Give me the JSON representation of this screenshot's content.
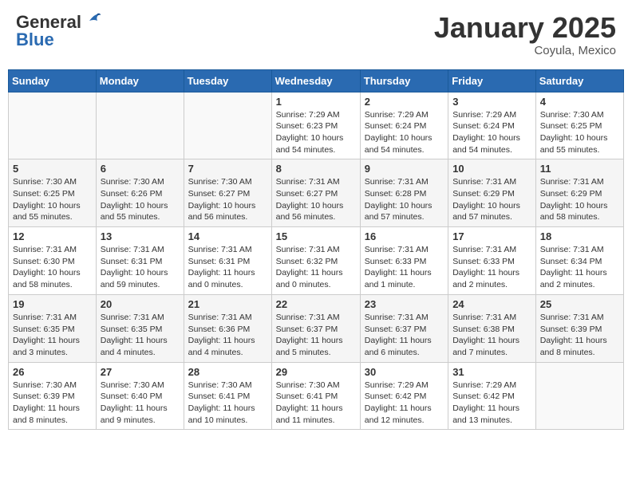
{
  "logo": {
    "line1": "General",
    "line2": "Blue"
  },
  "title": "January 2025",
  "subtitle": "Coyula, Mexico",
  "days_of_week": [
    "Sunday",
    "Monday",
    "Tuesday",
    "Wednesday",
    "Thursday",
    "Friday",
    "Saturday"
  ],
  "weeks": [
    [
      {
        "day": "",
        "info": ""
      },
      {
        "day": "",
        "info": ""
      },
      {
        "day": "",
        "info": ""
      },
      {
        "day": "1",
        "info": "Sunrise: 7:29 AM\nSunset: 6:23 PM\nDaylight: 10 hours\nand 54 minutes."
      },
      {
        "day": "2",
        "info": "Sunrise: 7:29 AM\nSunset: 6:24 PM\nDaylight: 10 hours\nand 54 minutes."
      },
      {
        "day": "3",
        "info": "Sunrise: 7:29 AM\nSunset: 6:24 PM\nDaylight: 10 hours\nand 54 minutes."
      },
      {
        "day": "4",
        "info": "Sunrise: 7:30 AM\nSunset: 6:25 PM\nDaylight: 10 hours\nand 55 minutes."
      }
    ],
    [
      {
        "day": "5",
        "info": "Sunrise: 7:30 AM\nSunset: 6:25 PM\nDaylight: 10 hours\nand 55 minutes."
      },
      {
        "day": "6",
        "info": "Sunrise: 7:30 AM\nSunset: 6:26 PM\nDaylight: 10 hours\nand 55 minutes."
      },
      {
        "day": "7",
        "info": "Sunrise: 7:30 AM\nSunset: 6:27 PM\nDaylight: 10 hours\nand 56 minutes."
      },
      {
        "day": "8",
        "info": "Sunrise: 7:31 AM\nSunset: 6:27 PM\nDaylight: 10 hours\nand 56 minutes."
      },
      {
        "day": "9",
        "info": "Sunrise: 7:31 AM\nSunset: 6:28 PM\nDaylight: 10 hours\nand 57 minutes."
      },
      {
        "day": "10",
        "info": "Sunrise: 7:31 AM\nSunset: 6:29 PM\nDaylight: 10 hours\nand 57 minutes."
      },
      {
        "day": "11",
        "info": "Sunrise: 7:31 AM\nSunset: 6:29 PM\nDaylight: 10 hours\nand 58 minutes."
      }
    ],
    [
      {
        "day": "12",
        "info": "Sunrise: 7:31 AM\nSunset: 6:30 PM\nDaylight: 10 hours\nand 58 minutes."
      },
      {
        "day": "13",
        "info": "Sunrise: 7:31 AM\nSunset: 6:31 PM\nDaylight: 10 hours\nand 59 minutes."
      },
      {
        "day": "14",
        "info": "Sunrise: 7:31 AM\nSunset: 6:31 PM\nDaylight: 11 hours\nand 0 minutes."
      },
      {
        "day": "15",
        "info": "Sunrise: 7:31 AM\nSunset: 6:32 PM\nDaylight: 11 hours\nand 0 minutes."
      },
      {
        "day": "16",
        "info": "Sunrise: 7:31 AM\nSunset: 6:33 PM\nDaylight: 11 hours\nand 1 minute."
      },
      {
        "day": "17",
        "info": "Sunrise: 7:31 AM\nSunset: 6:33 PM\nDaylight: 11 hours\nand 2 minutes."
      },
      {
        "day": "18",
        "info": "Sunrise: 7:31 AM\nSunset: 6:34 PM\nDaylight: 11 hours\nand 2 minutes."
      }
    ],
    [
      {
        "day": "19",
        "info": "Sunrise: 7:31 AM\nSunset: 6:35 PM\nDaylight: 11 hours\nand 3 minutes."
      },
      {
        "day": "20",
        "info": "Sunrise: 7:31 AM\nSunset: 6:35 PM\nDaylight: 11 hours\nand 4 minutes."
      },
      {
        "day": "21",
        "info": "Sunrise: 7:31 AM\nSunset: 6:36 PM\nDaylight: 11 hours\nand 4 minutes."
      },
      {
        "day": "22",
        "info": "Sunrise: 7:31 AM\nSunset: 6:37 PM\nDaylight: 11 hours\nand 5 minutes."
      },
      {
        "day": "23",
        "info": "Sunrise: 7:31 AM\nSunset: 6:37 PM\nDaylight: 11 hours\nand 6 minutes."
      },
      {
        "day": "24",
        "info": "Sunrise: 7:31 AM\nSunset: 6:38 PM\nDaylight: 11 hours\nand 7 minutes."
      },
      {
        "day": "25",
        "info": "Sunrise: 7:31 AM\nSunset: 6:39 PM\nDaylight: 11 hours\nand 8 minutes."
      }
    ],
    [
      {
        "day": "26",
        "info": "Sunrise: 7:30 AM\nSunset: 6:39 PM\nDaylight: 11 hours\nand 8 minutes."
      },
      {
        "day": "27",
        "info": "Sunrise: 7:30 AM\nSunset: 6:40 PM\nDaylight: 11 hours\nand 9 minutes."
      },
      {
        "day": "28",
        "info": "Sunrise: 7:30 AM\nSunset: 6:41 PM\nDaylight: 11 hours\nand 10 minutes."
      },
      {
        "day": "29",
        "info": "Sunrise: 7:30 AM\nSunset: 6:41 PM\nDaylight: 11 hours\nand 11 minutes."
      },
      {
        "day": "30",
        "info": "Sunrise: 7:29 AM\nSunset: 6:42 PM\nDaylight: 11 hours\nand 12 minutes."
      },
      {
        "day": "31",
        "info": "Sunrise: 7:29 AM\nSunset: 6:42 PM\nDaylight: 11 hours\nand 13 minutes."
      },
      {
        "day": "",
        "info": ""
      }
    ]
  ]
}
